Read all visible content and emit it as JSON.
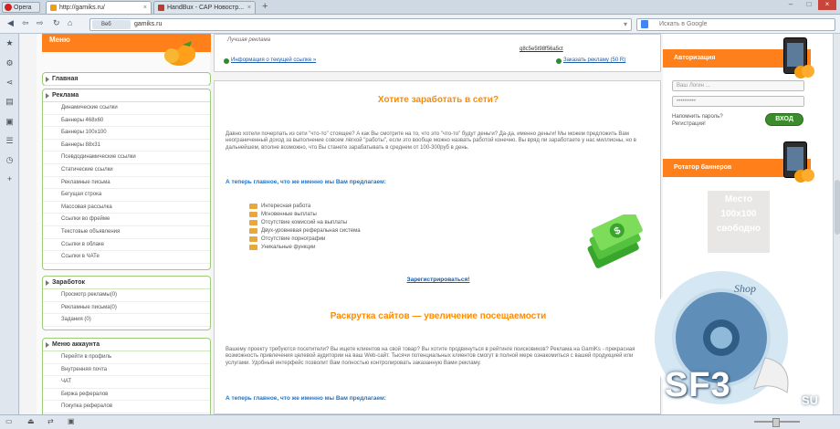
{
  "browser": {
    "opera_label": "Opera",
    "tabs": [
      {
        "label": "http://gamiks.ru/"
      },
      {
        "label": "HandBux - САР Новостр..."
      }
    ],
    "addr_badge": "Веб",
    "url": "gamiks.ru",
    "search_placeholder": "Искать в Google"
  },
  "left": {
    "menu_title": "Меню",
    "sections": [
      {
        "title": "Главная",
        "items": []
      },
      {
        "title": "Реклама",
        "items": [
          "Динамические ссылки",
          "Баннеры 468х60",
          "Баннеры 100х100",
          "Баннеры 88х31",
          "Псевдодинамические ссылки",
          "Статические ссылки",
          "Рекламные письма",
          "Бегущая строка",
          "Массовая рассылка",
          "Ссылки во фрейме",
          "Текстовые объявления",
          "Ссылки в облаке",
          "Ссылки в ЧАТе"
        ]
      },
      {
        "title": "Заработок",
        "items": [
          "Просмотр рекламы(0)",
          "Рекламные письма(0)",
          "Задания (0)"
        ]
      },
      {
        "title": "Меню аккаунта",
        "items": [
          "Перейти в профиль",
          "Внутренняя почта",
          "ЧАТ",
          "Биржа рефералов",
          "Покупка рефералов"
        ]
      }
    ]
  },
  "main": {
    "ad_label": "Лучшая реклама",
    "ad_code": "q8c5e5t98f56a5ct",
    "ad_info": "Информация о текущей ссылке »",
    "ad_show": "Заказать рекламу (50 R)",
    "title1": "Хотите заработать в сети?",
    "para1": "Давно хотели почерпать из сети \"что-то\" стоящее? А как Вы смотрите на то, что это \"что-то\" будут деньги? Да-да, именно деньги! Мы можем предложить Вам неограниченный доход за выполнение совсем лёгкой \"работы\", если это вообще можно назвать работой конечно. Вы вряд ли заработаете у нас миллионы, но в дальнейшем, вполне возможно, что Вы станете зарабатывать в среднем от 100-300руб в день.",
    "subtitle": "А теперь главное, что же именно мы Вам предлагаем:",
    "features": [
      "Интересная работа",
      "Мгновенные выплаты",
      "Отсутствие комиссий на выплаты",
      "Двух-уровневая реферальная система",
      "Отсутствие порнографии",
      "Уникальные функции"
    ],
    "register": "Зарегистрироваться!",
    "title2": "Раскрутка сайтов — увеличение посещаемости",
    "para2": "Вашему проекту требуются посетители? Вы ищете клиентов на свой товар? Вы хотите продвинуться в рейтинге поисковиков? Реклама на GamiKs - прекрасная возможность привлечения целевой аудитории на ваш Web-сайт. Тысячи потенциальных клиентов смогут в полной мере ознакомиться с вашей продукцией или услугами. Удобный интерфейс позволит Вам полностью контролировать заказанную Вами рекламу.",
    "subtitle2": "А теперь главное, что же именно мы Вам предлагаем:"
  },
  "right": {
    "auth_title": "Авторизация",
    "login_placeholder": "Ваш Логин ...",
    "pass_value": "••••••••••",
    "forgot": "Напомнить пароль?",
    "register": "Регистрация!",
    "login_btn": "ВХОД",
    "rotator_title": "Ротатор баннеров",
    "banner_text": [
      "Место",
      "100x100",
      "свободно"
    ]
  },
  "watermark": {
    "shop": "Shop",
    "sf3": "SF3",
    "su": "SU"
  },
  "colors": {
    "accent": "#ff7f1a",
    "green": "#3c8b2d",
    "link": "#1a5aa8"
  }
}
